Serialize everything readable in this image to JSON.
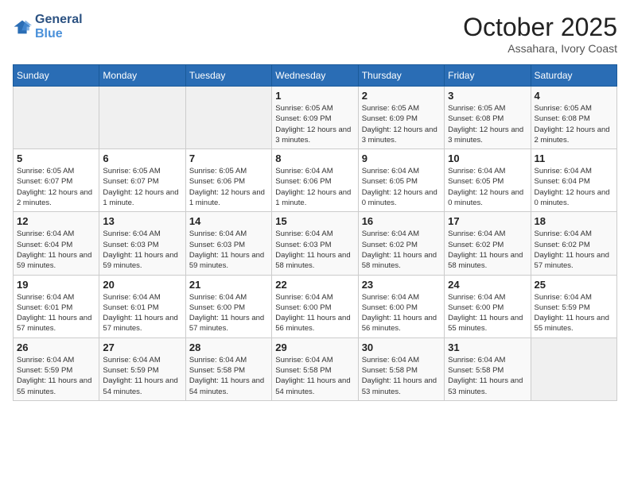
{
  "logo": {
    "line1": "General",
    "line2": "Blue"
  },
  "title": "October 2025",
  "location": "Assahara, Ivory Coast",
  "weekdays": [
    "Sunday",
    "Monday",
    "Tuesday",
    "Wednesday",
    "Thursday",
    "Friday",
    "Saturday"
  ],
  "weeks": [
    [
      {
        "day": "",
        "info": ""
      },
      {
        "day": "",
        "info": ""
      },
      {
        "day": "",
        "info": ""
      },
      {
        "day": "1",
        "info": "Sunrise: 6:05 AM\nSunset: 6:09 PM\nDaylight: 12 hours and 3 minutes."
      },
      {
        "day": "2",
        "info": "Sunrise: 6:05 AM\nSunset: 6:09 PM\nDaylight: 12 hours and 3 minutes."
      },
      {
        "day": "3",
        "info": "Sunrise: 6:05 AM\nSunset: 6:08 PM\nDaylight: 12 hours and 3 minutes."
      },
      {
        "day": "4",
        "info": "Sunrise: 6:05 AM\nSunset: 6:08 PM\nDaylight: 12 hours and 2 minutes."
      }
    ],
    [
      {
        "day": "5",
        "info": "Sunrise: 6:05 AM\nSunset: 6:07 PM\nDaylight: 12 hours and 2 minutes."
      },
      {
        "day": "6",
        "info": "Sunrise: 6:05 AM\nSunset: 6:07 PM\nDaylight: 12 hours and 1 minute."
      },
      {
        "day": "7",
        "info": "Sunrise: 6:05 AM\nSunset: 6:06 PM\nDaylight: 12 hours and 1 minute."
      },
      {
        "day": "8",
        "info": "Sunrise: 6:04 AM\nSunset: 6:06 PM\nDaylight: 12 hours and 1 minute."
      },
      {
        "day": "9",
        "info": "Sunrise: 6:04 AM\nSunset: 6:05 PM\nDaylight: 12 hours and 0 minutes."
      },
      {
        "day": "10",
        "info": "Sunrise: 6:04 AM\nSunset: 6:05 PM\nDaylight: 12 hours and 0 minutes."
      },
      {
        "day": "11",
        "info": "Sunrise: 6:04 AM\nSunset: 6:04 PM\nDaylight: 12 hours and 0 minutes."
      }
    ],
    [
      {
        "day": "12",
        "info": "Sunrise: 6:04 AM\nSunset: 6:04 PM\nDaylight: 11 hours and 59 minutes."
      },
      {
        "day": "13",
        "info": "Sunrise: 6:04 AM\nSunset: 6:03 PM\nDaylight: 11 hours and 59 minutes."
      },
      {
        "day": "14",
        "info": "Sunrise: 6:04 AM\nSunset: 6:03 PM\nDaylight: 11 hours and 59 minutes."
      },
      {
        "day": "15",
        "info": "Sunrise: 6:04 AM\nSunset: 6:03 PM\nDaylight: 11 hours and 58 minutes."
      },
      {
        "day": "16",
        "info": "Sunrise: 6:04 AM\nSunset: 6:02 PM\nDaylight: 11 hours and 58 minutes."
      },
      {
        "day": "17",
        "info": "Sunrise: 6:04 AM\nSunset: 6:02 PM\nDaylight: 11 hours and 58 minutes."
      },
      {
        "day": "18",
        "info": "Sunrise: 6:04 AM\nSunset: 6:02 PM\nDaylight: 11 hours and 57 minutes."
      }
    ],
    [
      {
        "day": "19",
        "info": "Sunrise: 6:04 AM\nSunset: 6:01 PM\nDaylight: 11 hours and 57 minutes."
      },
      {
        "day": "20",
        "info": "Sunrise: 6:04 AM\nSunset: 6:01 PM\nDaylight: 11 hours and 57 minutes."
      },
      {
        "day": "21",
        "info": "Sunrise: 6:04 AM\nSunset: 6:00 PM\nDaylight: 11 hours and 57 minutes."
      },
      {
        "day": "22",
        "info": "Sunrise: 6:04 AM\nSunset: 6:00 PM\nDaylight: 11 hours and 56 minutes."
      },
      {
        "day": "23",
        "info": "Sunrise: 6:04 AM\nSunset: 6:00 PM\nDaylight: 11 hours and 56 minutes."
      },
      {
        "day": "24",
        "info": "Sunrise: 6:04 AM\nSunset: 6:00 PM\nDaylight: 11 hours and 55 minutes."
      },
      {
        "day": "25",
        "info": "Sunrise: 6:04 AM\nSunset: 5:59 PM\nDaylight: 11 hours and 55 minutes."
      }
    ],
    [
      {
        "day": "26",
        "info": "Sunrise: 6:04 AM\nSunset: 5:59 PM\nDaylight: 11 hours and 55 minutes."
      },
      {
        "day": "27",
        "info": "Sunrise: 6:04 AM\nSunset: 5:59 PM\nDaylight: 11 hours and 54 minutes."
      },
      {
        "day": "28",
        "info": "Sunrise: 6:04 AM\nSunset: 5:58 PM\nDaylight: 11 hours and 54 minutes."
      },
      {
        "day": "29",
        "info": "Sunrise: 6:04 AM\nSunset: 5:58 PM\nDaylight: 11 hours and 54 minutes."
      },
      {
        "day": "30",
        "info": "Sunrise: 6:04 AM\nSunset: 5:58 PM\nDaylight: 11 hours and 53 minutes."
      },
      {
        "day": "31",
        "info": "Sunrise: 6:04 AM\nSunset: 5:58 PM\nDaylight: 11 hours and 53 minutes."
      },
      {
        "day": "",
        "info": ""
      }
    ]
  ]
}
